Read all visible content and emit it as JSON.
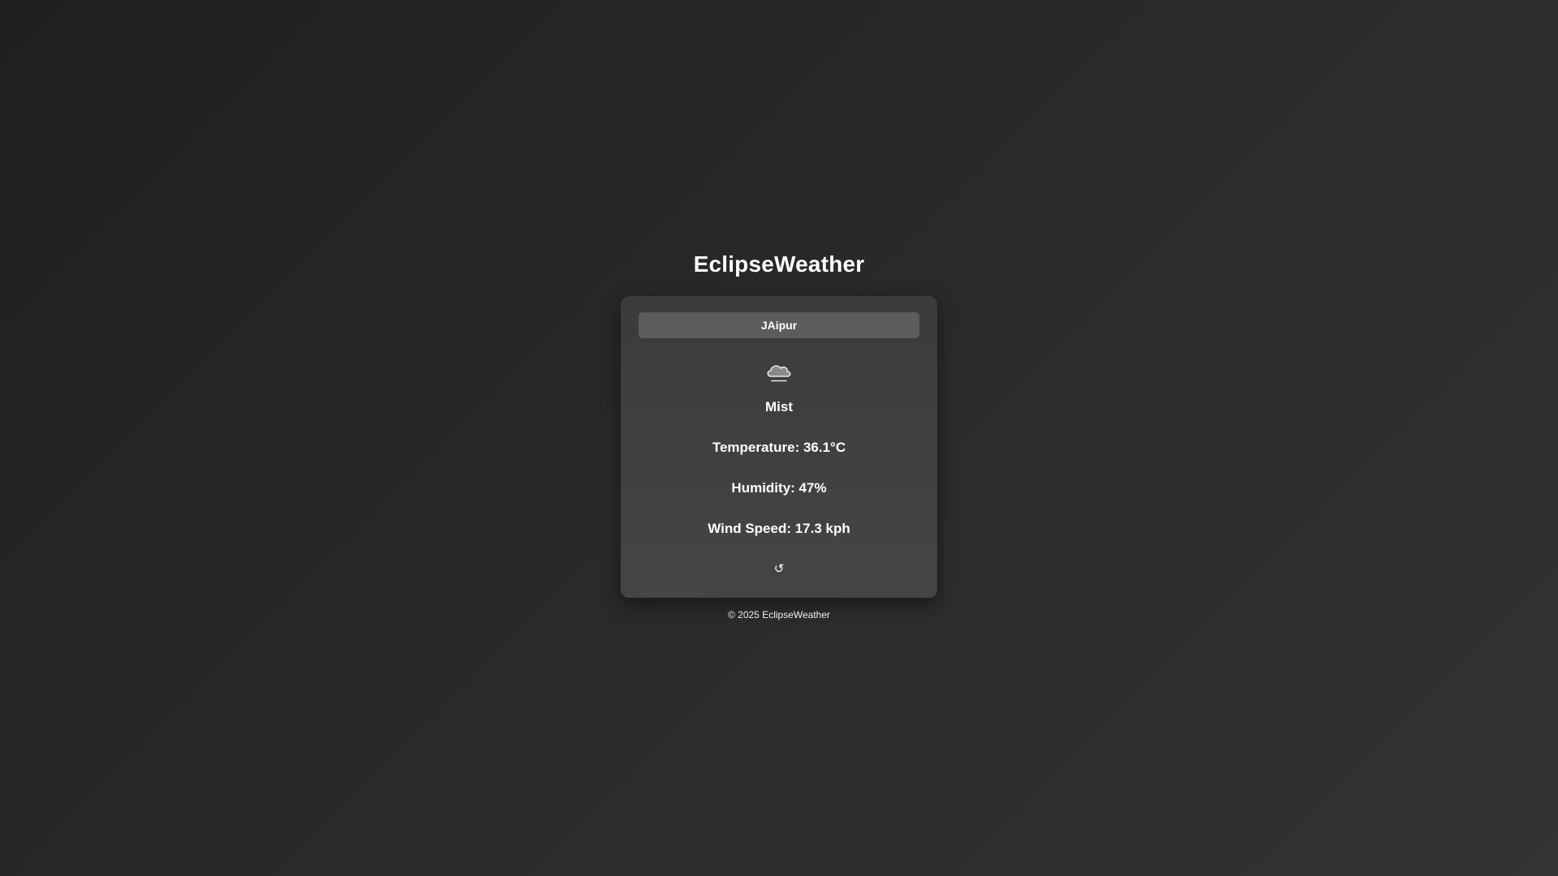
{
  "app": {
    "title": "EclipseWeather"
  },
  "search": {
    "value": "JAipur"
  },
  "weather": {
    "icon": "cloud-mist-icon",
    "condition": "Mist",
    "temperature": "Temperature: 36.1°C",
    "humidity": "Humidity: 47%",
    "wind_speed": "Wind Speed: 17.3 kph"
  },
  "actions": {
    "refresh_label": "↺"
  },
  "footer": {
    "text": "© 2025 EclipseWeather"
  },
  "colors": {
    "background": "#2a2a2a",
    "card": "#404040",
    "input": "#5c5c5c",
    "text": "#ffffff"
  }
}
